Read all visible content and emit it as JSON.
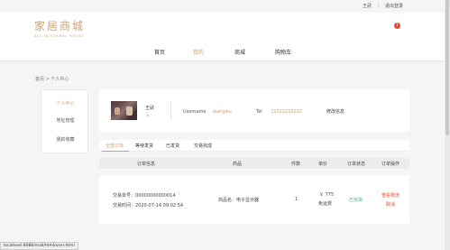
{
  "topbar": {
    "user": "王武",
    "separator": "|",
    "logout": "退出登录"
  },
  "logo": {
    "cn": "家居商城",
    "en": "ALL IN FORMAL HOUSE"
  },
  "cart": {
    "badge": "1"
  },
  "nav": [
    {
      "label": "首页"
    },
    {
      "label": "我的"
    },
    {
      "label": "商城"
    },
    {
      "label": "购物车"
    }
  ],
  "breadcrumb": "首页 > 个人中心",
  "sidebar": [
    {
      "label": "个人中心"
    },
    {
      "label": "地址管理"
    },
    {
      "label": "我的收藏"
    }
  ],
  "profile": {
    "name": "王武",
    "edit": "✎",
    "username_label": "Username",
    "username_value": "wangwu",
    "tel_label": "Tel",
    "tel_value": "22222222222",
    "edit_button": "修改信息"
  },
  "tabs": [
    {
      "label": "全部订单"
    },
    {
      "label": "等待发货"
    },
    {
      "label": "已发货"
    },
    {
      "label": "交易完成"
    }
  ],
  "table": {
    "headers": [
      "订单信息",
      "商品",
      "件数",
      "单价",
      "订单状态",
      "订单操作"
    ],
    "rows": [
      {
        "order_no": "交易单号：00000000000014",
        "order_time": "交易时间：2020-07-14 09:02:54",
        "product": "商品名：电子显示器",
        "qty": "1",
        "price": "￥ 775",
        "shipping": "免运费",
        "status": "已完货",
        "action1": "查看物流",
        "action2": "取消"
      }
    ]
  },
  "statusbar": "localhost:8088/mall/html/user.html",
  "colors": {
    "accent": "#c9a27a",
    "badge": "#e8472f",
    "success": "#2bb673"
  }
}
